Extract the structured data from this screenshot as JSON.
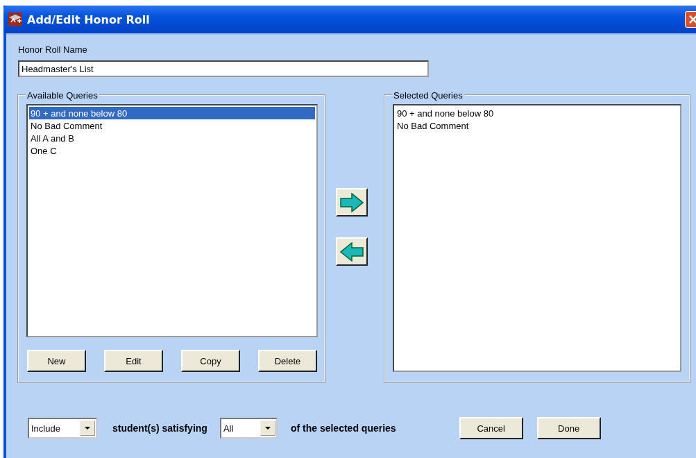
{
  "window": {
    "title": "Add/Edit Honor Roll"
  },
  "name_field": {
    "label": "Honor Roll Name",
    "value": "Headmaster's List"
  },
  "available": {
    "title": "Available Queries",
    "items": [
      {
        "label": "90 + and none below 80",
        "selected": true
      },
      {
        "label": "No Bad Comment",
        "selected": false
      },
      {
        "label": "All A and B",
        "selected": false
      },
      {
        "label": "One C",
        "selected": false
      }
    ],
    "buttons": [
      {
        "label": "New"
      },
      {
        "label": "Edit"
      },
      {
        "label": "Copy"
      },
      {
        "label": "Delete"
      }
    ]
  },
  "transfer": [
    {
      "kind": "add"
    },
    {
      "kind": "remove"
    }
  ],
  "selected": {
    "title": "Selected Queries",
    "items": [
      {
        "label": "90 + and none below 80",
        "selected": false
      },
      {
        "label": "No Bad Comment",
        "selected": false
      }
    ]
  },
  "footer": {
    "mode": {
      "value": "Include"
    },
    "text_1": "student(s) satisfying",
    "quantifier": {
      "value": "All"
    },
    "text_2": "of the selected queries",
    "buttons": [
      {
        "label": "Cancel"
      },
      {
        "label": "Done"
      }
    ]
  }
}
